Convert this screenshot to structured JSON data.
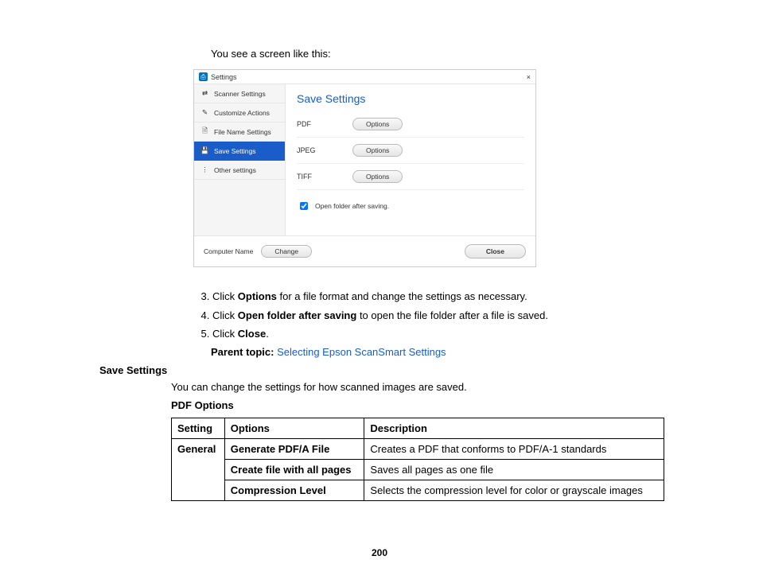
{
  "intro": "You see a screen like this:",
  "screenshot": {
    "window_title": "Settings",
    "close_glyph": "×",
    "sidebar": [
      {
        "icon_name": "scanner-icon",
        "glyph": "⇄",
        "label": "Scanner Settings",
        "active": false
      },
      {
        "icon_name": "customize-icon",
        "glyph": "✎",
        "label": "Customize Actions",
        "active": false
      },
      {
        "icon_name": "file-name-icon",
        "glyph": "🗎",
        "label": "File Name Settings",
        "active": false
      },
      {
        "icon_name": "save-settings-icon",
        "glyph": "💾",
        "label": "Save Settings",
        "active": true
      },
      {
        "icon_name": "other-settings-icon",
        "glyph": "⋮",
        "label": "Other settings",
        "active": false
      }
    ],
    "main_heading": "Save Settings",
    "rows": [
      {
        "label": "PDF",
        "button": "Options"
      },
      {
        "label": "JPEG",
        "button": "Options"
      },
      {
        "label": "TIFF",
        "button": "Options"
      }
    ],
    "checkbox_label": "Open folder after saving.",
    "footer": {
      "computer_label": "Computer Name",
      "change_button": "Change",
      "close_button": "Close"
    }
  },
  "steps": [
    {
      "num": "3",
      "pre": "Click ",
      "bold": "Options",
      "post": " for a file format and change the settings as necessary."
    },
    {
      "num": "4",
      "pre": "Click ",
      "bold": "Open folder after saving",
      "post": " to open the file folder after a file is saved."
    },
    {
      "num": "5",
      "pre": "Click ",
      "bold": "Close",
      "post": "."
    }
  ],
  "parent_topic_label": "Parent topic:",
  "parent_topic_link": "Selecting Epson ScanSmart Settings",
  "section_heading": "Save Settings",
  "section_text": "You can change the settings for how scanned images are saved.",
  "subheading": "PDF Options",
  "table": {
    "headers": [
      "Setting",
      "Options",
      "Description"
    ],
    "rows": [
      {
        "setting": "General",
        "option": "Generate PDF/A File",
        "desc": "Creates a PDF that conforms to PDF/A-1 standards"
      },
      {
        "setting": "",
        "option": "Create file with all pages",
        "desc": "Saves all pages as one file"
      },
      {
        "setting": "",
        "option": "Compression Level",
        "desc": "Selects the compression level for color or grayscale images"
      }
    ]
  },
  "page_number": "200"
}
